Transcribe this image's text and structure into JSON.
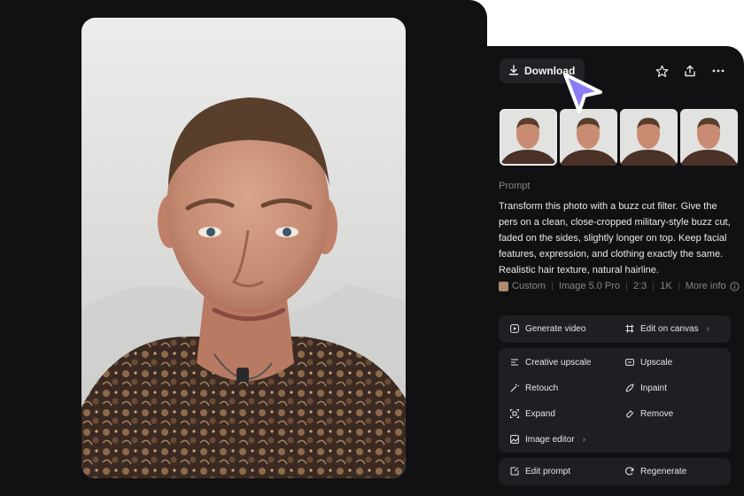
{
  "toolbar": {
    "download_label": "Download",
    "icons": [
      "download-icon",
      "star-icon",
      "share-icon",
      "more-icon"
    ]
  },
  "thumbnails": [
    {
      "state": "selected"
    },
    {
      "state": "default"
    },
    {
      "state": "default"
    },
    {
      "state": "default"
    }
  ],
  "prompt": {
    "label": "Prompt",
    "text": "Transform this photo with a buzz cut filter. Give the pers on a clean, close-cropped military-style buzz cut, faded on the sides, slightly longer on top. Keep facial features, expression, and clothing exactly the same. Realistic hair texture, natural hairline."
  },
  "meta": {
    "style": "Custom",
    "model": "Image 5.0 Pro",
    "ratio": "2:3",
    "resolution": "1K",
    "more": "More info"
  },
  "actions": {
    "generate_video": "Generate video",
    "edit_on_canvas": "Edit on canvas",
    "creative_upscale": "Creative upscale",
    "upscale": "Upscale",
    "retouch": "Retouch",
    "inpaint": "Inpaint",
    "expand": "Expand",
    "remove": "Remove",
    "image_editor": "Image editor",
    "edit_prompt": "Edit prompt",
    "regenerate": "Regenerate"
  },
  "colors": {
    "panel": "#111113",
    "button": "#222226",
    "group": "#1f1f23",
    "cursor": "#8a7cf5"
  }
}
